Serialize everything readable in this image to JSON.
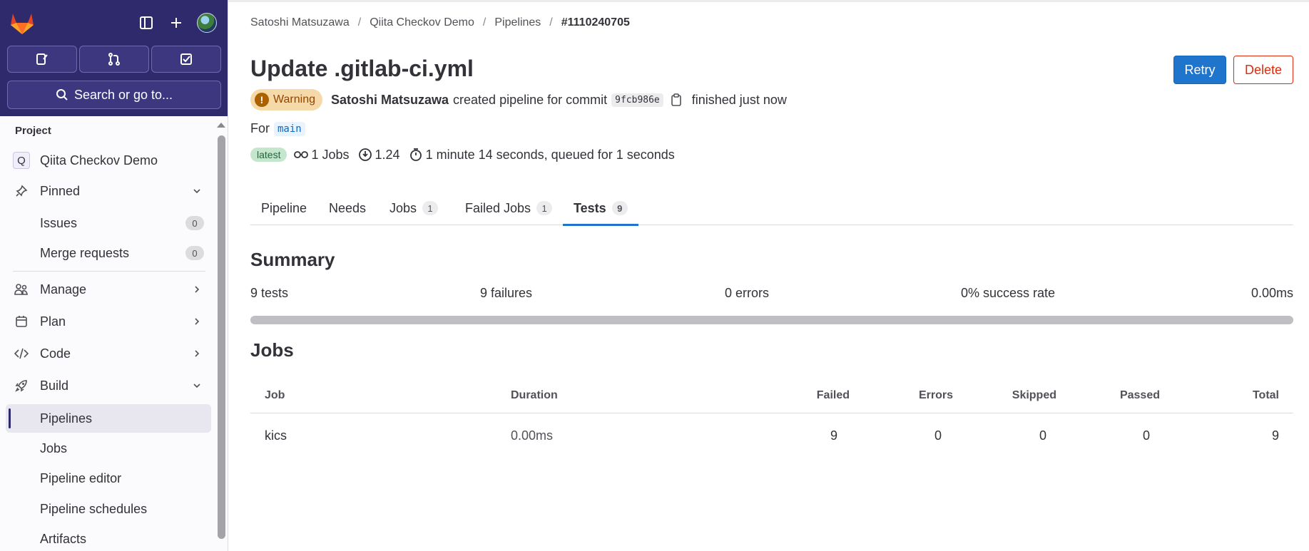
{
  "sidebar": {
    "search_label": "Search or go to...",
    "section_label": "Project",
    "project_initial": "Q",
    "project_name": "Qiita Checkov Demo",
    "items": [
      {
        "label": "Pinned"
      },
      {
        "label": "Issues",
        "count": "0"
      },
      {
        "label": "Merge requests",
        "count": "0"
      },
      {
        "label": "Manage"
      },
      {
        "label": "Plan"
      },
      {
        "label": "Code"
      },
      {
        "label": "Build"
      },
      {
        "label": "Pipelines"
      },
      {
        "label": "Jobs"
      },
      {
        "label": "Pipeline editor"
      },
      {
        "label": "Pipeline schedules"
      },
      {
        "label": "Artifacts"
      }
    ]
  },
  "breadcrumb": [
    "Satoshi Matsuzawa",
    "Qiita Checkov Demo",
    "Pipelines",
    "#1110240705"
  ],
  "header": {
    "title": "Update .gitlab-ci.yml",
    "retry_label": "Retry",
    "delete_label": "Delete"
  },
  "pipeline_meta": {
    "status": "Warning",
    "author": "Satoshi Matsuzawa",
    "action_text": "created pipeline for commit",
    "commit_sha": "9fcb986e",
    "finished_text": "finished just now",
    "for_label": "For",
    "ref": "main",
    "latest_badge": "latest",
    "jobs_text": "1 Jobs",
    "compute_text": "1.24",
    "duration_text": "1 minute 14 seconds, queued for 1 seconds"
  },
  "tabs": [
    {
      "label": "Pipeline"
    },
    {
      "label": "Needs"
    },
    {
      "label": "Jobs",
      "count": "1"
    },
    {
      "label": "Failed Jobs",
      "count": "1"
    },
    {
      "label": "Tests",
      "count": "9"
    }
  ],
  "summary": {
    "heading": "Summary",
    "tests": "9 tests",
    "failures": "9 failures",
    "errors": "0 errors",
    "success_rate": "0% success rate",
    "duration": "0.00ms",
    "success_fraction": 0
  },
  "jobs": {
    "heading": "Jobs",
    "columns": [
      "Job",
      "Duration",
      "Failed",
      "Errors",
      "Skipped",
      "Passed",
      "Total"
    ],
    "rows": [
      {
        "job": "kics",
        "duration": "0.00ms",
        "failed": "9",
        "errors": "0",
        "skipped": "0",
        "passed": "0",
        "total": "9"
      }
    ]
  },
  "colors": {
    "sidebar_top": "#2f2a6b",
    "accent": "#1f75cb",
    "danger": "#dd2b0e",
    "warning_bg": "#f5d9a8"
  }
}
